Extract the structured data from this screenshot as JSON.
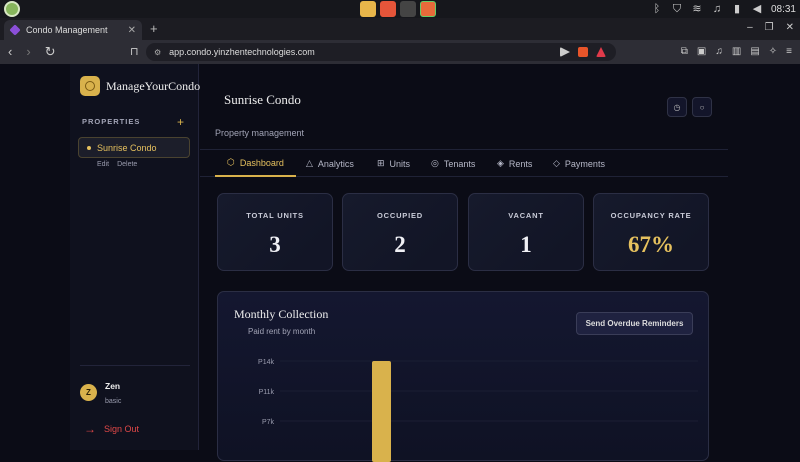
{
  "browser": {
    "tab_title": "Condo Management",
    "url": "app.condo.yinzhentechnologies.com",
    "new_tab": "+",
    "clock": "08:31"
  },
  "sidebar": {
    "brand": "ManageYourCondo",
    "properties_heading": "PROPERTIES",
    "add_symbol": "+",
    "properties": [
      {
        "name": "Sunrise Condo"
      }
    ],
    "edit_label": "Edit",
    "delete_label": "Delete",
    "user": {
      "initial": "Z",
      "name": "Zen",
      "plan": "basic"
    },
    "signout_label": "Sign Out",
    "accent": "#d9b24c"
  },
  "header": {
    "title": "Sunrise Condo",
    "subtitle": "Property management"
  },
  "tabs": [
    {
      "label": "Dashboard",
      "icon": "hexagon-icon"
    },
    {
      "label": "Analytics",
      "icon": "triangle-icon"
    },
    {
      "label": "Units",
      "icon": "grid-icon"
    },
    {
      "label": "Tenants",
      "icon": "circle-icon"
    },
    {
      "label": "Rents",
      "icon": "diamond-icon"
    },
    {
      "label": "Payments",
      "icon": "diamond-outline-icon"
    }
  ],
  "stats": [
    {
      "label": "TOTAL UNITS",
      "value": "3"
    },
    {
      "label": "OCCUPIED",
      "value": "2"
    },
    {
      "label": "VACANT",
      "value": "1"
    },
    {
      "label": "OCCUPANCY RATE",
      "value": "67%"
    }
  ],
  "collection": {
    "title": "Monthly Collection",
    "subtitle": "Paid rent by month",
    "button": "Send Overdue Reminders"
  },
  "chart_data": {
    "type": "bar",
    "y_ticks": [
      "P14k",
      "P11k",
      "P7k"
    ],
    "ylim": [
      0,
      14000
    ],
    "values": [
      14000
    ],
    "bar_color": "#d9b24c"
  }
}
